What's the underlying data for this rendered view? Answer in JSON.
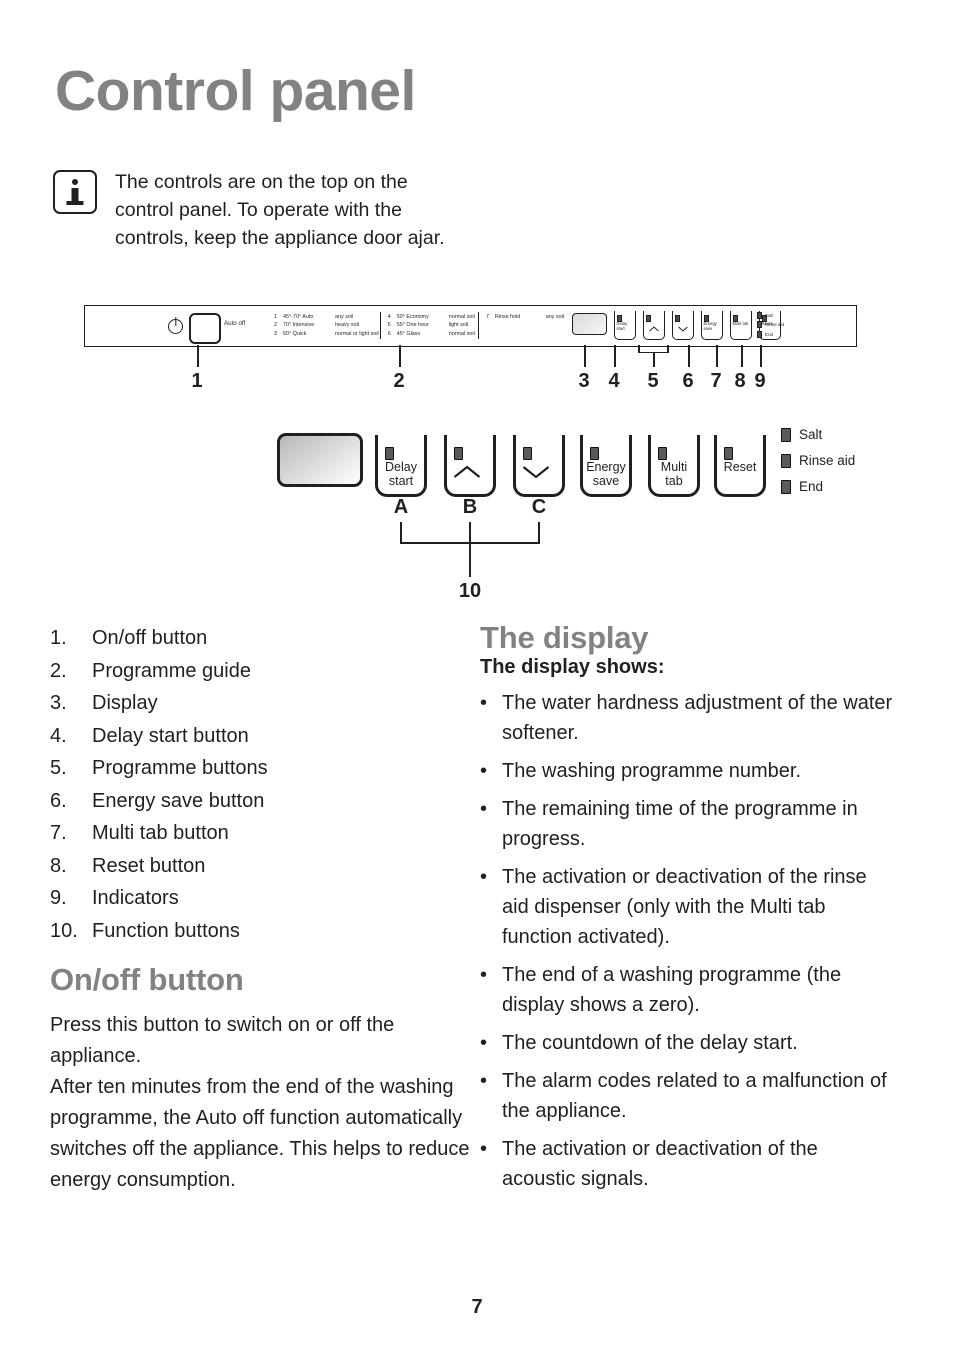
{
  "page": {
    "title": "Control panel",
    "number": "7"
  },
  "info_note": {
    "icon": "info-icon",
    "text": "The controls are on the top on the control panel. To operate with the controls, keep the appliance door ajar."
  },
  "panel_strip": {
    "power_symbol": "power-icon",
    "auto_off_label": "Auto off",
    "programme_guide": {
      "col1": [
        {
          "n": "1",
          "name": "45°-70° Auto",
          "soil": "any soil"
        },
        {
          "n": "2",
          "name": "70° Intensive",
          "soil": "heavy soil"
        },
        {
          "n": "3",
          "name": "60° Quick",
          "soil": "normal or light soil"
        }
      ],
      "col2": [
        {
          "n": "4",
          "name": "50° Economy",
          "soil": "normal soil"
        },
        {
          "n": "5",
          "name": "55° One hour",
          "soil": "light soil"
        },
        {
          "n": "6",
          "name": "45° Glass",
          "soil": "normal soil"
        }
      ],
      "col3": [
        {
          "n": "7",
          "name": "Rinse hold",
          "soil": "any soil"
        }
      ]
    },
    "buttons": [
      {
        "label": "Delay start",
        "icon": "none"
      },
      {
        "label": "",
        "icon": "chevron-up-icon"
      },
      {
        "label": "",
        "icon": "chevron-down-icon"
      },
      {
        "label": "Energy save",
        "icon": "none"
      },
      {
        "label": "Multi tab",
        "icon": "none"
      },
      {
        "label": "Reset",
        "icon": "none"
      }
    ],
    "indicators": [
      "Salt",
      "Rinse aid",
      "End"
    ]
  },
  "callouts": {
    "numbers": [
      "1",
      "2",
      "3",
      "4",
      "5",
      "6",
      "7",
      "8",
      "9"
    ],
    "letters": [
      "A",
      "B",
      "C"
    ],
    "group_number": "10"
  },
  "enlarged": {
    "buttons": [
      {
        "line1": "Delay",
        "line2": "start",
        "icon": "none"
      },
      {
        "line1": "",
        "line2": "",
        "icon": "chevron-up-icon"
      },
      {
        "line1": "",
        "line2": "",
        "icon": "chevron-down-icon"
      },
      {
        "line1": "Energy",
        "line2": "save",
        "icon": "none"
      },
      {
        "line1": "Multi",
        "line2": "tab",
        "icon": "none"
      },
      {
        "line1": "Reset",
        "line2": "",
        "icon": "none"
      }
    ],
    "indicators": [
      "Salt",
      "Rinse aid",
      "End"
    ]
  },
  "numbered_list": [
    {
      "n": "1.",
      "label": "On/off button"
    },
    {
      "n": "2.",
      "label": "Programme guide"
    },
    {
      "n": "3.",
      "label": "Display"
    },
    {
      "n": "4.",
      "label": "Delay start button"
    },
    {
      "n": "5.",
      "label": "Programme buttons"
    },
    {
      "n": "6.",
      "label": "Energy save button"
    },
    {
      "n": "7.",
      "label": "Multi tab button"
    },
    {
      "n": "8.",
      "label": "Reset button"
    },
    {
      "n": "9.",
      "label": "Indicators"
    },
    {
      "n": "10.",
      "label": "Function buttons"
    }
  ],
  "onoff_section": {
    "heading": "On/off button",
    "paragraph1": "Press this button to switch on or off the appliance.",
    "paragraph2": "After ten minutes from the end of the washing programme, the Auto off function automatically switches off the appliance. This helps to reduce energy consumption."
  },
  "display_section": {
    "heading": "The display",
    "subheading": "The display shows:",
    "bullets": [
      "The water hardness adjustment of the water softener.",
      "The washing programme number.",
      "The remaining time of the programme in progress.",
      "The activation or deactivation of the rinse aid dispenser (only with the Multi tab function activated).",
      "The end of a washing programme (the display shows a zero).",
      "The countdown of the delay start.",
      "The alarm codes related to a malfunction of the appliance.",
      "The activation or deactivation of the acoustic signals."
    ]
  },
  "colors": {
    "heading_grey": "#828282",
    "body_black": "#231f20",
    "led_grey": "#5a5a5a"
  }
}
